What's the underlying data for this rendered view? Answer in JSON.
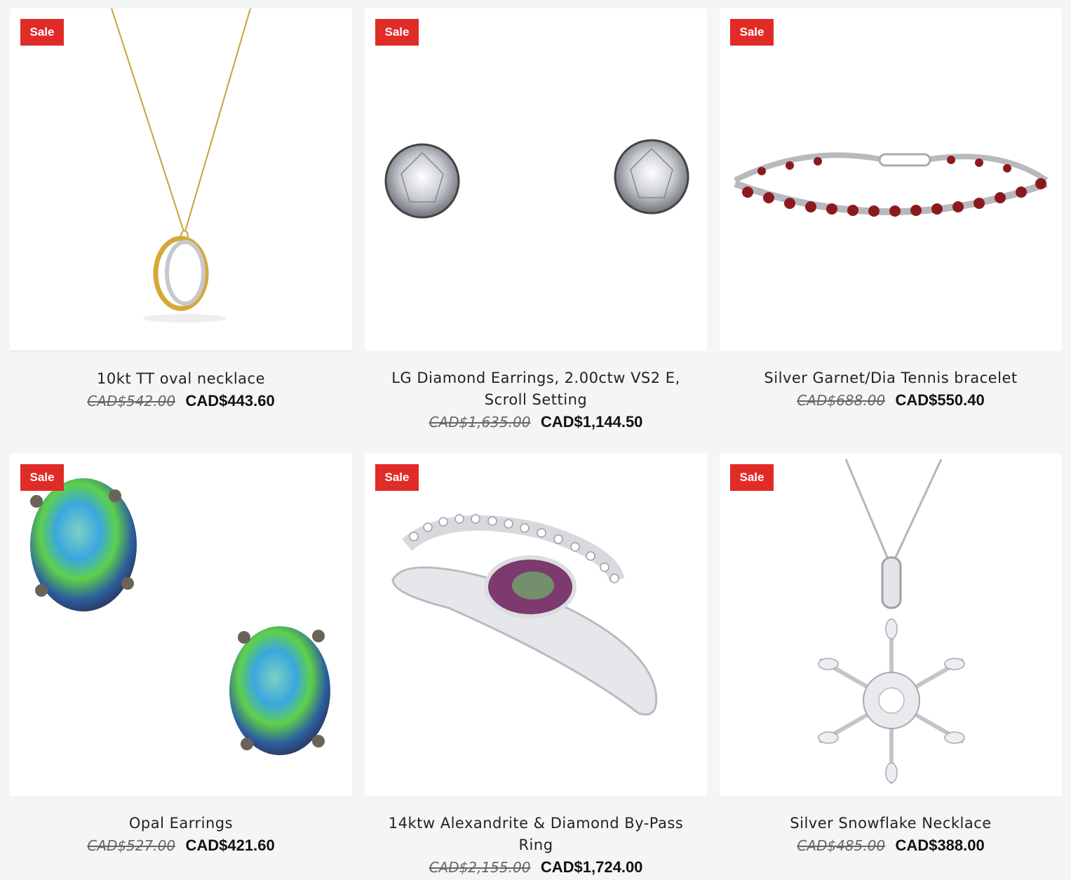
{
  "products": [
    {
      "badge": "Sale",
      "title": "10kt TT oval necklace",
      "old_price": "CAD$542.00",
      "new_price": "CAD$443.60",
      "image": "necklace-oval-image"
    },
    {
      "badge": "Sale",
      "title": "LG Diamond Earrings, 2.00ctw VS2 E, Scroll Setting",
      "old_price": "CAD$1,635.00",
      "new_price": "CAD$1,144.50",
      "image": "diamond-earrings-image"
    },
    {
      "badge": "Sale",
      "title": "Silver Garnet/Dia Tennis bracelet",
      "old_price": "CAD$688.00",
      "new_price": "CAD$550.40",
      "image": "tennis-bracelet-image"
    },
    {
      "badge": "Sale",
      "title": "Opal Earrings",
      "old_price": "CAD$527.00",
      "new_price": "CAD$421.60",
      "image": "opal-earrings-image"
    },
    {
      "badge": "Sale",
      "title": "14ktw Alexandrite & Diamond By-Pass Ring",
      "old_price": "CAD$2,155.00",
      "new_price": "CAD$1,724.00",
      "image": "bypass-ring-image"
    },
    {
      "badge": "Sale",
      "title": "Silver Snowflake Necklace",
      "old_price": "CAD$485.00",
      "new_price": "CAD$388.00",
      "image": "snowflake-necklace-image"
    }
  ],
  "colors": {
    "sale_badge": "#e02b27",
    "background": "#f4f5f7"
  }
}
